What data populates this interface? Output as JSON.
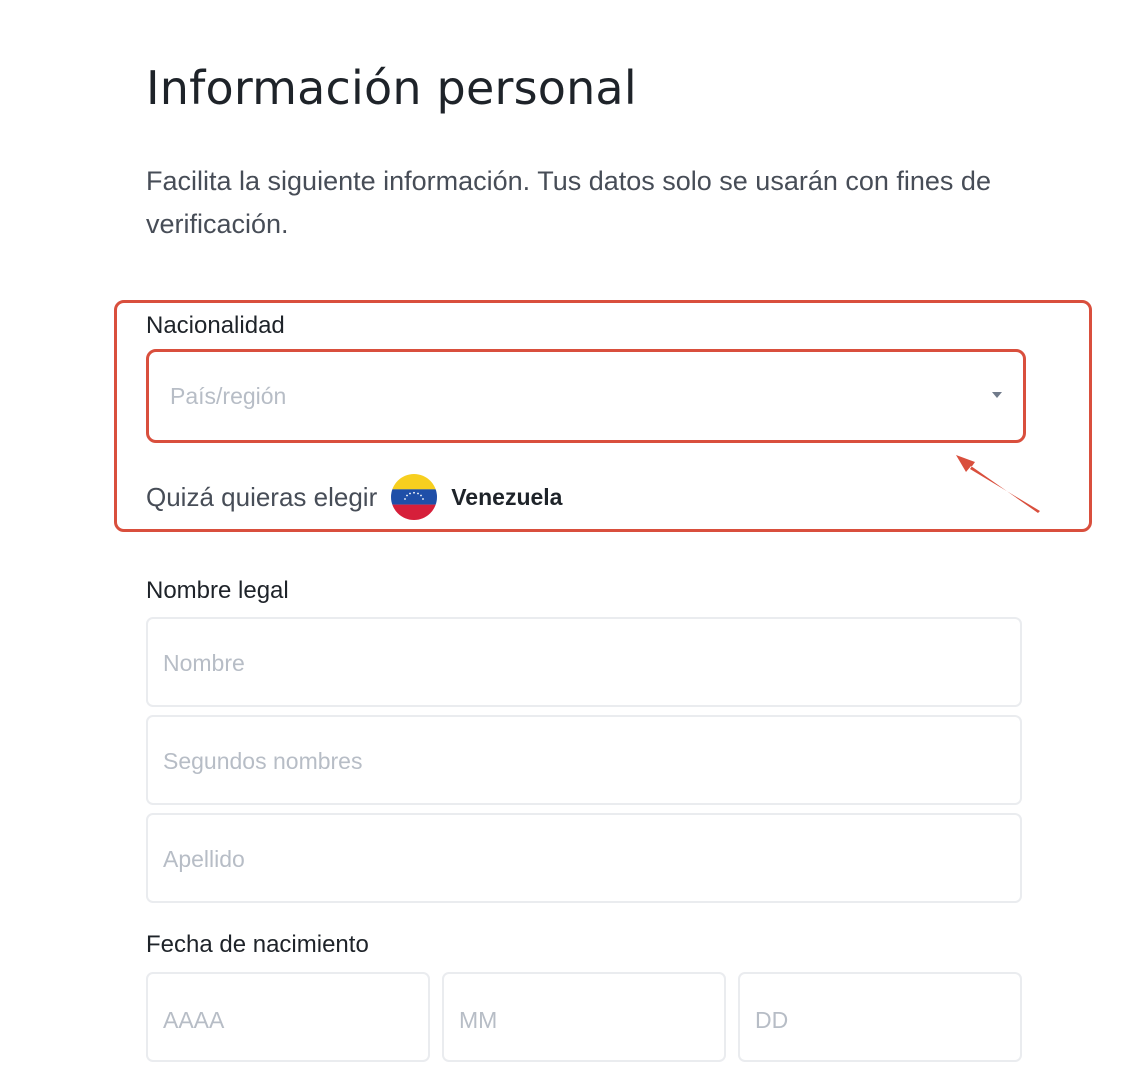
{
  "header": {
    "title": "Información personal",
    "subtitle": "Facilita la siguiente información. Tus datos solo se usarán con fines de verificación."
  },
  "nationality": {
    "label": "Nacionalidad",
    "select_placeholder": "País/región",
    "suggest_text": "Quizá quieras elegir",
    "suggest_country": "Venezuela",
    "suggest_flag_icon": "venezuela-flag-icon"
  },
  "legal_name": {
    "label": "Nombre legal",
    "first_name_placeholder": "Nombre",
    "middle_name_placeholder": "Segundos nombres",
    "last_name_placeholder": "Apellido"
  },
  "birth_date": {
    "label": "Fecha de nacimiento",
    "year_placeholder": "AAAA",
    "month_placeholder": "MM",
    "day_placeholder": "DD"
  },
  "annotation": {
    "highlight_color": "#d94f3d"
  }
}
